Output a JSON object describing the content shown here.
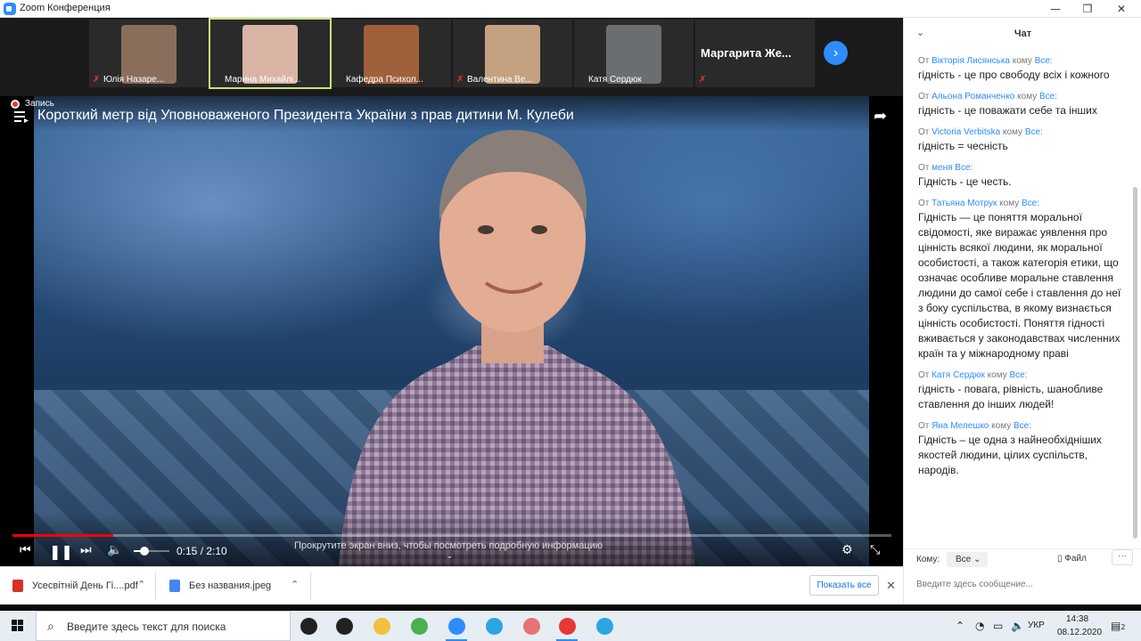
{
  "window": {
    "title": "Zoom Конференция",
    "controls": [
      "—",
      "❐",
      "✕"
    ]
  },
  "participants": [
    {
      "name": "Юлія Назаре...",
      "muted": true,
      "color": "#8a6e5c",
      "active": false
    },
    {
      "name": "Марина Михайлі...",
      "muted": false,
      "color": "#d9b4a4",
      "active": true
    },
    {
      "name": "Кафедра Психол...",
      "muted": false,
      "color": "#a0603c",
      "active": false
    },
    {
      "name": "Валентина Ве...",
      "muted": true,
      "color": "#c4a180",
      "active": false
    },
    {
      "name": "Катя Сердюк",
      "muted": false,
      "color": "#6b6e70",
      "active": false
    },
    {
      "name": "Маргарита  Же...",
      "muted": true,
      "color": "#2a2a2a",
      "active": false
    }
  ],
  "video": {
    "record_label": "Запись",
    "title": "Короткий метр від Уповноваженого Президента України з прав дитини М. Кулеби",
    "time": "0:15 / 2:10",
    "progress": 0.115,
    "volume": 0.3,
    "scroll_hint": "Прокрутите экран вниз, чтобы посмотреть подробную информацию"
  },
  "downloads": {
    "items": [
      {
        "name": "Усесвітній День Гі....pdf",
        "type": "PDF",
        "color": "#d93025"
      },
      {
        "name": "Без названия.jpeg",
        "type": "image",
        "color": "#4285f4"
      }
    ],
    "show_all": "Показать все"
  },
  "chat": {
    "title": "Чат",
    "messages": [
      {
        "prefix": "От ",
        "from": "Вікторія Лисянська",
        "mid": " кому ",
        "to": "Все:",
        "text": "гідність - це про свободу всіх і кожного"
      },
      {
        "prefix": "От ",
        "from": "Альона Романченко",
        "mid": " кому ",
        "to": "Все:",
        "text": "гідність - це поважати себе та інших"
      },
      {
        "prefix": "От ",
        "from": "Victoria Verbitska",
        "mid": " кому ",
        "to": "Все:",
        "text": "гідність = чесність"
      },
      {
        "prefix": "От ",
        "from": "меня",
        "mid": " ",
        "to": "Все:",
        "text": "Гідність - це честь."
      },
      {
        "prefix": "От ",
        "from": "Татьяна Мотрук",
        "mid": " кому ",
        "to": "Все:",
        "text": "Гідність — це поняття моральної свідомості, яке виражає уявлення про цінність всякої людини, як моральної особистості, а також категорія етики, що означає особливе моральне ставлення людини до самої себе і ставлення до неї з боку суспільства, в якому визнається цінність особистості. Поняття гідності вживається у законодавствах численних країн та у міжнародному праві"
      },
      {
        "prefix": "От ",
        "from": "Катя Сердюк",
        "mid": " кому ",
        "to": "Все:",
        "text": "гідність - повага, рівність, шанобливе ставлення до інших людей!"
      },
      {
        "prefix": "От ",
        "from": "Яна Мелешко",
        "mid": " кому ",
        "to": "Все:",
        "text": "Гідність – це одна з найнеобхідніших якостей людини, цілих суспільств, народів."
      }
    ],
    "to_label": "Кому:",
    "to_value": "Все",
    "file_label": "Файл",
    "more_label": "···",
    "input_placeholder": "Введите здесь сообщение..."
  },
  "taskbar": {
    "search_placeholder": "Введите здесь текст для поиска",
    "apps": [
      {
        "name": "cortana",
        "color": "#222222",
        "open": false
      },
      {
        "name": "task-view",
        "color": "#222222",
        "open": false
      },
      {
        "name": "file-explorer",
        "color": "#f0c040",
        "open": false
      },
      {
        "name": "utorrent",
        "color": "#4caf50",
        "open": false
      },
      {
        "name": "zoom",
        "color": "#2d8cff",
        "open": true
      },
      {
        "name": "telegram",
        "color": "#2ca5e0",
        "open": false
      },
      {
        "name": "snipping-tool",
        "color": "#e57373",
        "open": false
      },
      {
        "name": "chrome",
        "color": "#e53935",
        "open": true
      },
      {
        "name": "telegram-2",
        "color": "#2ca5e0",
        "open": false
      }
    ],
    "language": "УКР",
    "time": "14:38",
    "date": "08.12.2020",
    "notifications": "2"
  }
}
